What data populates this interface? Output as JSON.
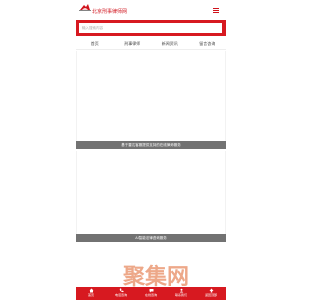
{
  "header": {
    "site_name": "北京刑事律师网",
    "logo_icon": "mountain-logo-icon",
    "menu_icon": "hamburger-menu-icon"
  },
  "search": {
    "placeholder": "输入搜索内容"
  },
  "nav": {
    "items": [
      {
        "label": "首页"
      },
      {
        "label": "刑事律师"
      },
      {
        "label": "新闻资讯"
      },
      {
        "label": "留言咨询"
      }
    ]
  },
  "cards": [
    {
      "caption": "基于雷达客服提供支持的在线律师服务"
    },
    {
      "caption": "AI智能法律咨询服务"
    }
  ],
  "bottom_tabs": [
    {
      "label": "首页",
      "icon": "home-icon"
    },
    {
      "label": "电话咨询",
      "icon": "phone-icon"
    },
    {
      "label": "在线咨询",
      "icon": "chat-icon"
    },
    {
      "label": "联系我们",
      "icon": "contact-icon"
    },
    {
      "label": "返回顶部",
      "icon": "arrow-up-icon"
    }
  ],
  "watermark": {
    "text": "聚集网"
  },
  "colors": {
    "accent": "#d71920",
    "caption_bg": "#727272",
    "watermark": "#e0622a"
  }
}
